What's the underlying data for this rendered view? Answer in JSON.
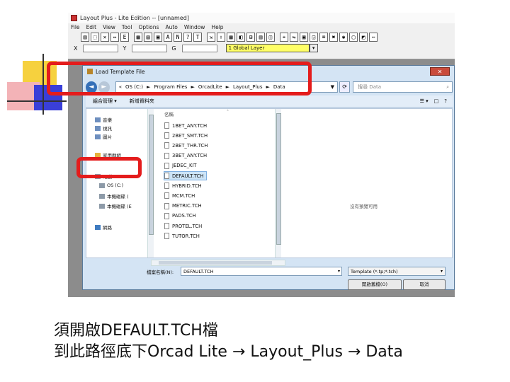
{
  "app": {
    "title": "Layout Plus - Lite Edition -- [unnamed]",
    "menu": [
      "File",
      "Edit",
      "View",
      "Tool",
      "Options",
      "Auto",
      "Window",
      "Help"
    ],
    "toolbar": [
      "▥",
      "⬚",
      "✕",
      "⇔",
      "E",
      "▦",
      "▤",
      "▣",
      "A",
      "N",
      "?",
      "T",
      "⇲",
      "⇳",
      "▦",
      "◧",
      "⊞",
      "▥",
      "◫",
      "⌖",
      "⇋",
      "▣",
      "◲",
      "⌧",
      "✖",
      "✱",
      "▢",
      "◩",
      "⋯"
    ],
    "coords": {
      "x_label": "X",
      "y_label": "Y",
      "g_label": "G",
      "layer": "1 Global Layer"
    }
  },
  "dialog": {
    "title": "Load Template File",
    "close": "✕",
    "address": {
      "parts": [
        "«",
        "OS (C:)",
        "►",
        "Program Files",
        "►",
        "OrcadLite",
        "►",
        "Layout_Plus",
        "►",
        "Data"
      ],
      "dropdown": "▼"
    },
    "search_placeholder": "搜尋 Data",
    "commands": {
      "organize": "組合管理 ▾",
      "new_folder": "新增資料夾",
      "view": "☰ ▾",
      "pane": "□",
      "help": "?"
    },
    "nav": [
      {
        "label": "音樂",
        "type": "lib"
      },
      {
        "label": "視訊",
        "type": "lib"
      },
      {
        "label": "圖片",
        "type": "lib"
      },
      {
        "label": "家用群組",
        "type": "home"
      },
      {
        "label": "電腦",
        "type": "pc"
      },
      {
        "label": "OS (C:)",
        "type": "drv"
      },
      {
        "label": "本機磁碟 (",
        "type": "drv"
      },
      {
        "label": "本機磁碟 (E",
        "type": "drv"
      },
      {
        "label": "網路",
        "type": "net"
      }
    ],
    "column_header": "名稱",
    "sort_indicator": "˄",
    "files": [
      "1BET_ANY.TCH",
      "2BET_SMT.TCH",
      "2BET_THR.TCH",
      "3BET_ANY.TCH",
      "JEDEC_KIT",
      "DEFAULT.TCH",
      "HYBRID.TCH",
      "MCM.TCH",
      "METRIC.TCH",
      "PADS.TCH",
      "PROTEL.TCH",
      "TUTOR.TCH"
    ],
    "selected_file": "DEFAULT.TCH",
    "preview_text": "沒有預覽可用",
    "filename_label": "檔案名稱(N):",
    "filename_value": "DEFAULT.TCH",
    "filetype": "Template (*.tp;*.tch)",
    "open_button": "開啟舊檔(O)",
    "cancel_button": "取消"
  },
  "caption": {
    "line1": "須開啟DEFAULT.TCH檔",
    "line2": "到此路徑底下Orcad Lite → Layout_Plus → Data"
  },
  "colors": {
    "highlight": "#e41c1c",
    "deco_yellow": "#f6d13e",
    "deco_pink": "#f3b3b7",
    "deco_blue": "#3a3fd8"
  }
}
